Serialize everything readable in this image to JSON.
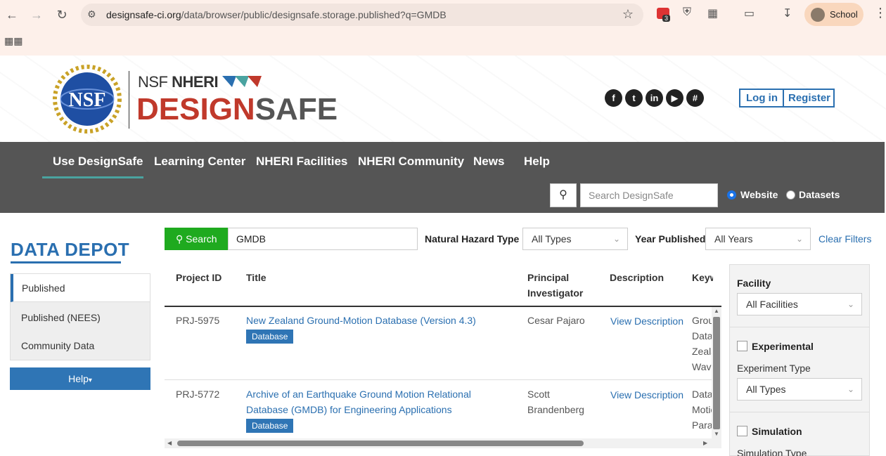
{
  "browser": {
    "url_domain": "designsafe-ci.org",
    "url_path": "/data/browser/public/designsafe.storage.published?q=GMDB",
    "extension_badge": "3",
    "profile_label": "School"
  },
  "header": {
    "brand_top_1": "NSF ",
    "brand_top_2": "NHERI",
    "brand_design": "DESIGN",
    "brand_safe": "SAFE",
    "nsf_text": "NSF",
    "social_icons": [
      "facebook-icon",
      "twitter-icon",
      "linkedin-icon",
      "youtube-icon",
      "slack-icon"
    ],
    "login_label": "Log in",
    "register_label": "Register"
  },
  "mainnav": {
    "items": [
      "Use DesignSafe",
      "Learning Center",
      "NHERI Facilities",
      "NHERI Community",
      "News",
      "Help"
    ],
    "search_placeholder": "Search DesignSafe",
    "radio_website": "Website",
    "radio_datasets": "Datasets"
  },
  "sidebar": {
    "title": "DATA DEPOT",
    "items": [
      "Published",
      "Published (NEES)",
      "Community Data"
    ],
    "help_label": "Help"
  },
  "filters": {
    "search_label": "Search",
    "query": "GMDB",
    "hazard_label": "Natural Hazard Type",
    "hazard_value": "All Types",
    "year_label": "Year Published",
    "year_value": "All Years",
    "clear_label": "Clear Filters"
  },
  "table": {
    "headers": {
      "project_id": "Project ID",
      "title": "Title",
      "pi_1": "Principal",
      "pi_2": "Investigator",
      "description": "Description",
      "keywords": "Keywords"
    },
    "rows": [
      {
        "id": "PRJ-5975",
        "title": "New Zealand Ground-Motion Database (Version 4.3)",
        "tag": "Database",
        "pi_1": "Cesar Pajaro",
        "pi_2": "",
        "desc": "View Description",
        "kw": [
          "Ground",
          "Databa",
          "Zealand",
          "Wave"
        ]
      },
      {
        "id": "PRJ-5772",
        "title_1": "Archive of an Earthquake Ground Motion Relational",
        "title_2": "Database (GMDB) for Engineering Applications",
        "tag": "Database",
        "pi_1": "Scott",
        "pi_2": "Brandenberg",
        "desc": "View Description",
        "kw": [
          "Databa",
          "Motion",
          "Param"
        ]
      }
    ]
  },
  "facets": {
    "facility_label": "Facility",
    "facility_value": "All Facilities",
    "experimental_label": "Experimental",
    "experiment_type_label": "Experiment Type",
    "experiment_type_value": "All Types",
    "simulation_label": "Simulation",
    "simulation_type_label": "Simulation Type"
  }
}
